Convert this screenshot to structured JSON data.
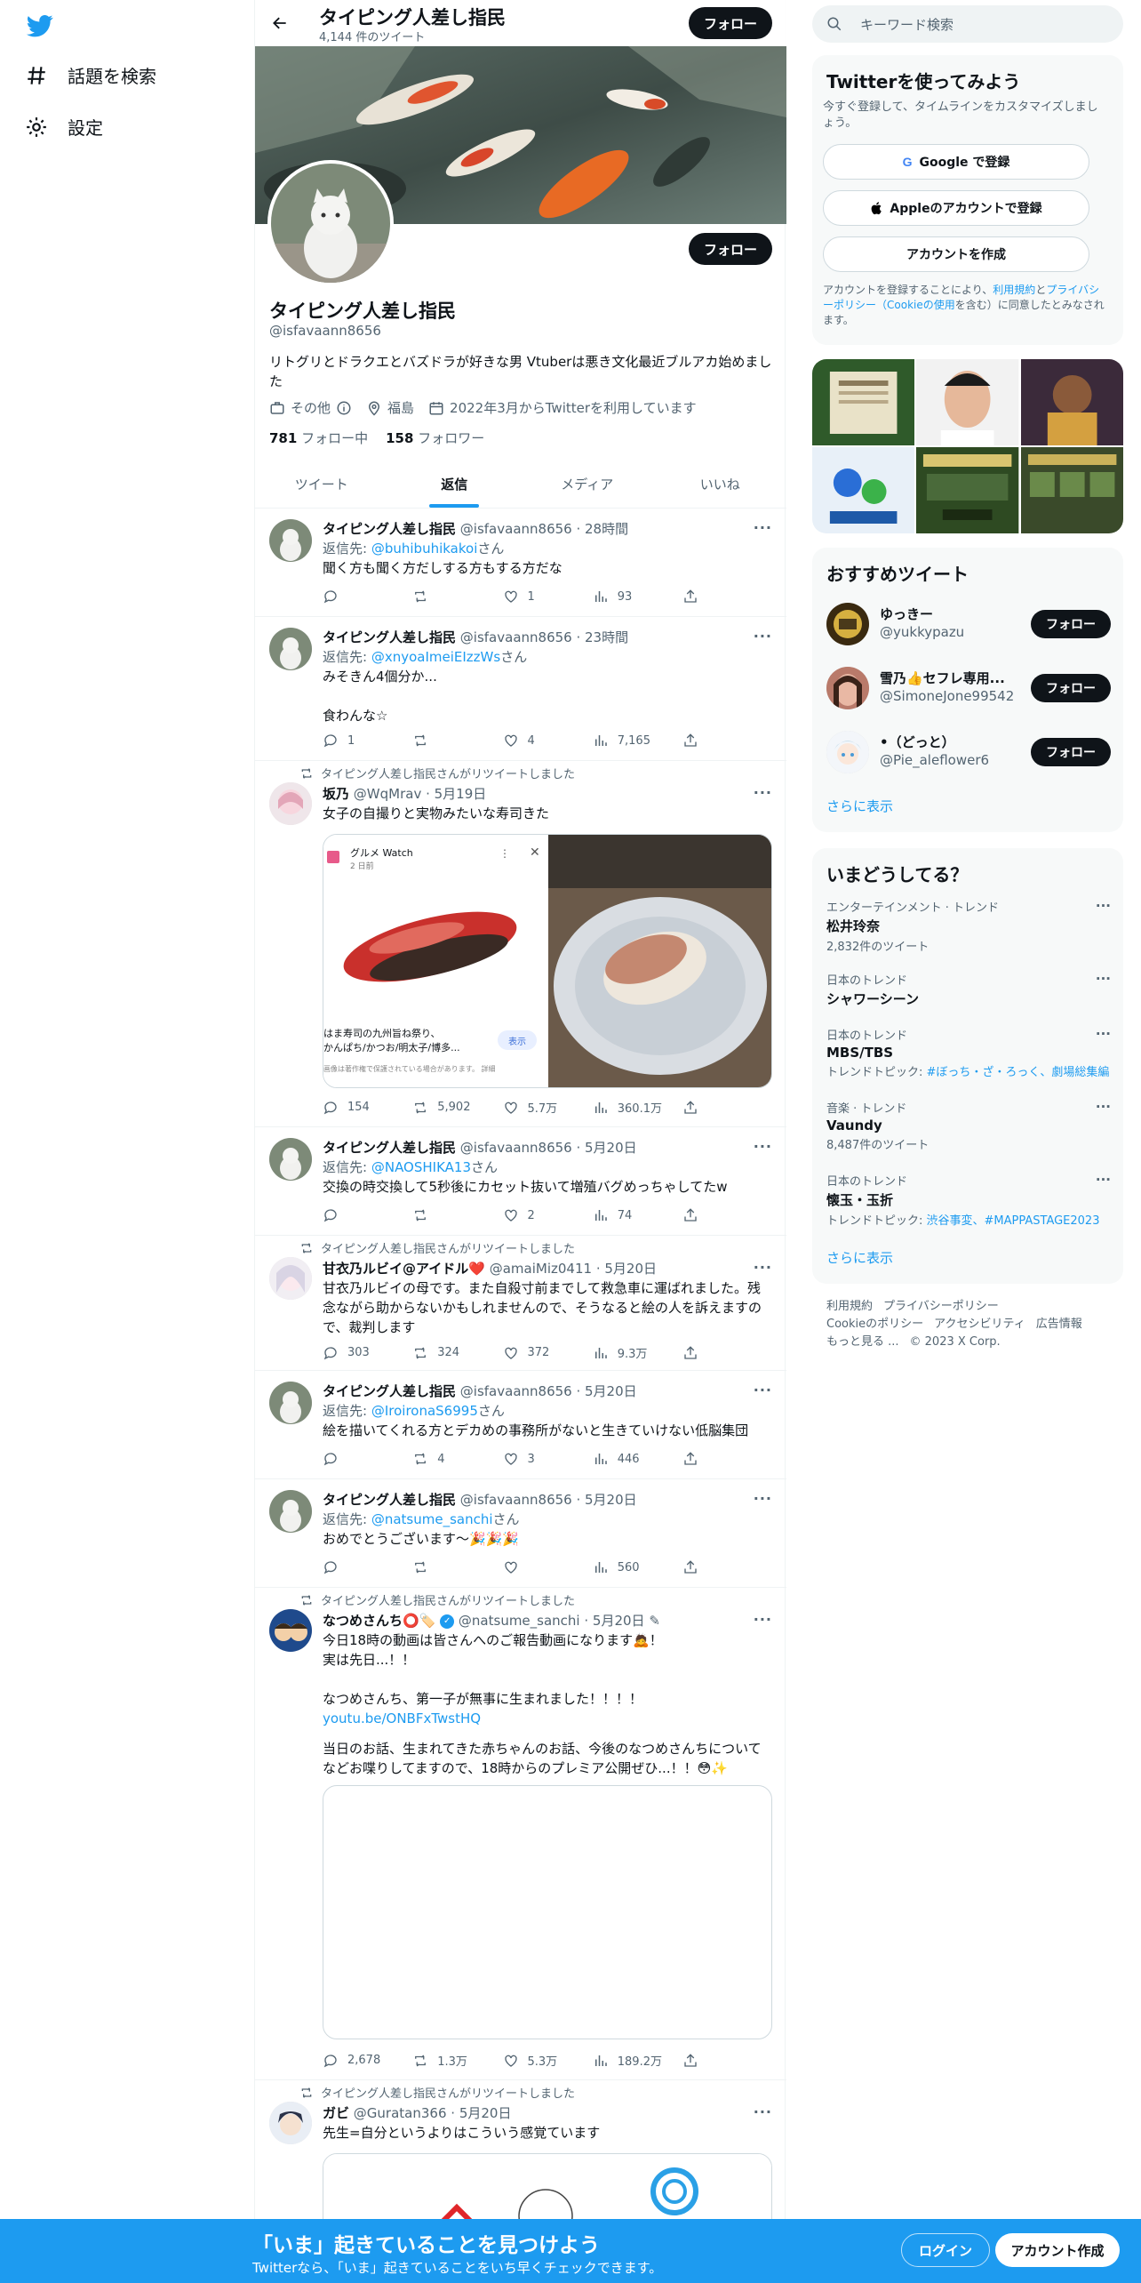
{
  "nav": {
    "explore_label": "話題を検索",
    "settings_label": "設定"
  },
  "profile": {
    "name": "タイピング人差し指民",
    "tweet_count": "4,144 件のツイート",
    "follow_label": "フォロー",
    "handle": "@isfavaann8656",
    "bio": "リトグリとドラクエとバズドラが好きな男 Vtuberは悪き文化最近ブルアカ始めました",
    "category": "その他",
    "location": "福島",
    "joined": "2022年3月からTwitterを利用しています",
    "following_count": "781",
    "following_label": "フォロー中",
    "followers_count": "158",
    "followers_label": "フォロワー"
  },
  "tabs": [
    "ツイート",
    "返信",
    "メディア",
    "いいね"
  ],
  "tweets": [
    {
      "name": "タイピング人差し指民",
      "handle": "@isfavaann8656",
      "time": "28時間",
      "reply_prefix": "返信先:",
      "reply_to": "@buhibuhikakoi",
      "reply_suffix": "さん",
      "text": "聞く方も聞く方だしする方もする方だな",
      "replies": "",
      "retweets": "",
      "likes": "1",
      "views": "93"
    },
    {
      "name": "タイピング人差し指民",
      "handle": "@isfavaann8656",
      "time": "23時間",
      "reply_prefix": "返信先:",
      "reply_to": "@xnyoaImeiEIzzWs",
      "reply_suffix": "さん",
      "text": "みそきん4個分か...\n\n食わんな☆",
      "replies": "1",
      "retweets": "",
      "likes": "4",
      "views": "7,165"
    },
    {
      "retweet_note": "タイピング人差し指民さんがリツイートしました",
      "name": "坂乃",
      "handle": "@WqMrav",
      "time": "5月19日",
      "text": "女子の自撮りと実物みたいな寿司きた",
      "card_source": "グルメ Watch",
      "card_time": "2 日前",
      "card_caption": "はま寿司の九州旨ね祭り、\nかんぱち/かつお/明太子/博多...",
      "card_note": "画像は著作権で保護されている場合があります。 詳細",
      "card_button": "表示",
      "replies": "154",
      "retweets": "5,902",
      "likes": "5.7万",
      "views": "360.1万"
    },
    {
      "name": "タイピング人差し指民",
      "handle": "@isfavaann8656",
      "time": "5月20日",
      "reply_prefix": "返信先:",
      "reply_to": "@NAOSHIKA13",
      "reply_suffix": "さん",
      "text": "交換の時交換して5秒後にカセット抜いて増殖バグめっちゃしてたw",
      "replies": "",
      "retweets": "",
      "likes": "2",
      "views": "74"
    },
    {
      "retweet_note": "タイピング人差し指民さんがリツイートしました",
      "name": "甘衣乃ルビイ@アイドル❤️",
      "handle": "@amaiMiz0411",
      "time": "5月20日",
      "text": "甘衣乃ルビイの母です。また自殺寸前までして救急車に運ばれました。残念ながら助からないかもしれませんので、そうなると絵の人を訴えますので、裁判します",
      "replies": "303",
      "retweets": "324",
      "likes": "372",
      "views": "9.3万"
    },
    {
      "name": "タイピング人差し指民",
      "handle": "@isfavaann8656",
      "time": "5月20日",
      "reply_prefix": "返信先:",
      "reply_to": "@IroironaS6995",
      "reply_suffix": "さん",
      "text": "絵を描いてくれる方とデカめの事務所がないと生きていけない低脳集団",
      "replies": "",
      "retweets": "4",
      "likes": "3",
      "views": "446"
    },
    {
      "name": "タイピング人差し指民",
      "handle": "@isfavaann8656",
      "time": "5月20日",
      "reply_prefix": "返信先:",
      "reply_to": "@natsume_sanchi",
      "reply_suffix": "さん",
      "text": "おめでとうございます〜🎉🎉🎉",
      "replies": "",
      "retweets": "",
      "likes": "",
      "views": "560"
    },
    {
      "retweet_note": "タイピング人差し指民さんがリツイートしました",
      "name": "なつめさんち⭕🏷️",
      "handle": "@natsume_sanchi",
      "time": "5月20日",
      "text_a": "今日18時の動画は皆さんへのご報告動画になります🙇！\n実は先日...！！\n\nなつめさんち、第一子が無事に生まれました！！！！",
      "link": "youtu.be/ONBFxTwstHQ",
      "text_b": "当日のお話、生まれてきた赤ちゃんのお話、今後のなつめさんちについてなどお喋りしてますので、18時からのプレミア公開ぜひ...！！😳✨",
      "replies": "2,678",
      "retweets": "1.3万",
      "likes": "5.3万",
      "views": "189.2万"
    },
    {
      "retweet_note": "タイピング人差し指民さんがリツイートしました",
      "name": "ガビ",
      "handle": "@Guratan366",
      "time": "5月20日",
      "text": "先生=自分というよりはこういう感覚ています"
    }
  ],
  "right": {
    "search_placeholder": "キーワード検索",
    "signup_title": "Twitterを使ってみよう",
    "signup_sub": "今すぐ登録して、タイムラインをカスタマイズしましょう。",
    "google_label": "Google で登録",
    "apple_label": "Appleのアカウントで登録",
    "create_label": "アカウントを作成",
    "terms_a": "アカウントを登録することにより、",
    "terms_link1": "利用規約",
    "terms_b": "と",
    "terms_link2": "プライバシーポリシー（Cookieの使用",
    "terms_c": "を含む）に同意したとみなされます。",
    "rec_title": "おすすめツイート",
    "recs": [
      {
        "name": "ゆっきー",
        "handle": "@yukkypazu"
      },
      {
        "name": "雪乃👍セフレ専用...",
        "handle": "@SimoneJone99542"
      },
      {
        "name": "•（どっと）",
        "handle": "@Pie_aleflower6"
      }
    ],
    "follow_label": "フォロー",
    "show_more": "さらに表示",
    "trends_title": "いまどうしてる？",
    "trends": [
      {
        "context": "エンターテインメント · トレンド",
        "name": "松井玲奈",
        "sub": "2,832件のツイート",
        "topics": ""
      },
      {
        "context": "日本のトレンド",
        "name": "シャワーシーン",
        "sub": "",
        "topics": ""
      },
      {
        "context": "日本のトレンド",
        "name": "MBS/TBS",
        "sub": "トレンドトピック: ",
        "topics": "#ぼっち・ざ・ろっく、劇場総集編"
      },
      {
        "context": "音楽 · トレンド",
        "name": "Vaundy",
        "sub": "8,487件のツイート",
        "topics": ""
      },
      {
        "context": "日本のトレンド",
        "name": "懐玉・玉折",
        "sub": "トレンドトピック: ",
        "topics": "渋谷事変、#MAPPASTAGE2023"
      }
    ],
    "footer": [
      "利用規約",
      "プライバシーポリシー",
      "Cookieのポリシー",
      "アクセシビリティ",
      "広告情報",
      "もっと見る ...",
      "© 2023 X Corp."
    ]
  },
  "bottom": {
    "title": "「いま」起きていることを見つけよう",
    "sub": "Twitterなら、「いま」起きていることをいち早くチェックできます。",
    "login": "ログイン",
    "signup": "アカウント作成"
  }
}
